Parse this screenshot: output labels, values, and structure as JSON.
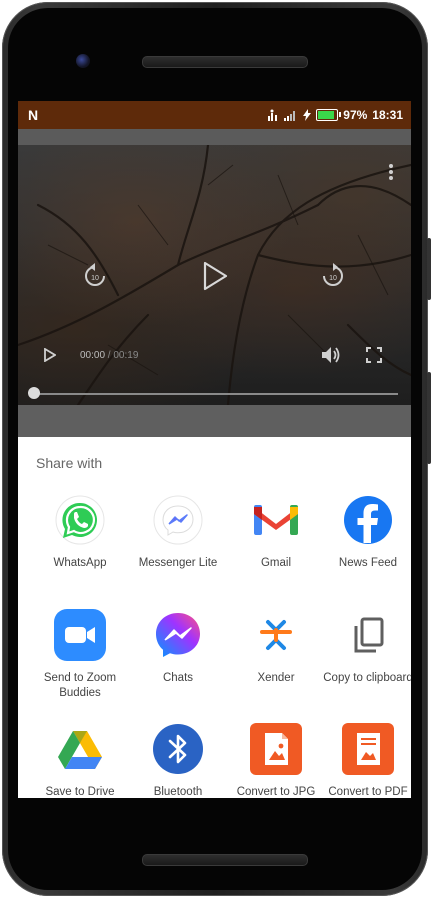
{
  "status_bar": {
    "notification_letter": "N",
    "battery_percent": "97%",
    "battery_level": 0.97,
    "time": "18:31"
  },
  "video": {
    "time_current": "00:00",
    "time_separator": " / ",
    "time_total": "00:19"
  },
  "share_sheet": {
    "title": "Share with",
    "apps": [
      {
        "label": "WhatsApp",
        "icon": "whatsapp-icon"
      },
      {
        "label": "Messenger Lite",
        "icon": "messenger-lite-icon"
      },
      {
        "label": "Gmail",
        "icon": "gmail-icon"
      },
      {
        "label": "News Feed",
        "icon": "facebook-icon"
      },
      {
        "label": "Send to Zoom Buddies",
        "icon": "zoom-icon"
      },
      {
        "label": "Chats",
        "icon": "messenger-icon"
      },
      {
        "label": "Xender",
        "icon": "xender-icon"
      },
      {
        "label": "Copy to clipboard",
        "icon": "copy-icon"
      },
      {
        "label": "Save to Drive",
        "icon": "google-drive-icon"
      },
      {
        "label": "Bluetooth",
        "icon": "bluetooth-icon"
      },
      {
        "label": "Convert to JPG",
        "icon": "image-convert-icon"
      },
      {
        "label": "Convert to PDF",
        "icon": "pdf-convert-icon"
      }
    ]
  },
  "colors": {
    "status_bar": "#5e2a0a",
    "battery_fill": "#3ad84a",
    "sheet_bg": "#ffffff"
  }
}
